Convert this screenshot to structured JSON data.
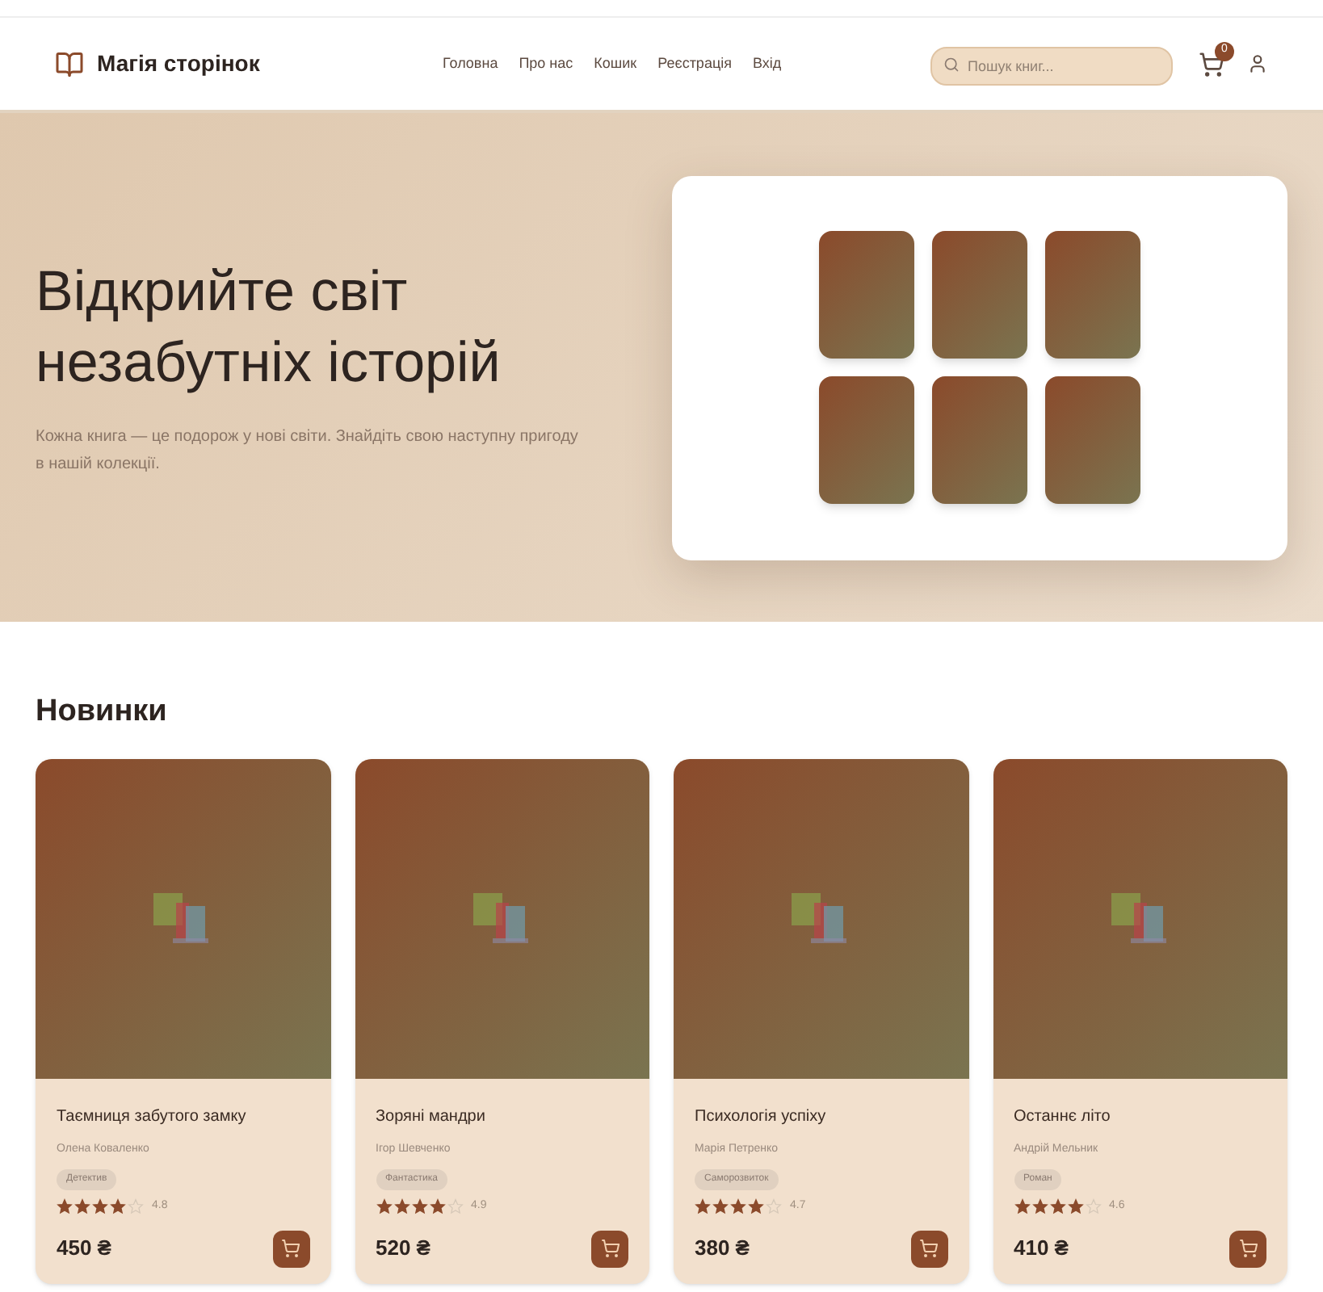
{
  "header": {
    "logo": "Магія сторінок",
    "nav": [
      {
        "label": "Головна"
      },
      {
        "label": "Про нас"
      },
      {
        "label": "Кошик"
      },
      {
        "label": "Реєстрація"
      },
      {
        "label": "Вхід"
      }
    ],
    "search": {
      "placeholder": "Пошук книг..."
    },
    "cart_count": "0"
  },
  "hero": {
    "title": "Відкрийте світ незабутніх історій",
    "subtitle": "Кожна книга — це подорож у нові світи. Знайдіть свою наступну пригоду в нашій колекції."
  },
  "section_title": "Новинки",
  "books": [
    {
      "title": "Таємниця забутого замку",
      "author": "Олена Коваленко",
      "genre": "Детектив",
      "stars": 4,
      "rating": "4.8",
      "price": "450 ₴"
    },
    {
      "title": "Зоряні мандри",
      "author": "Ігор Шевченко",
      "genre": "Фантастика",
      "stars": 4,
      "rating": "4.9",
      "price": "520 ₴"
    },
    {
      "title": "Психологія успіху",
      "author": "Марія Петренко",
      "genre": "Саморозвиток",
      "stars": 4,
      "rating": "4.7",
      "price": "380 ₴"
    },
    {
      "title": "Останнє літо",
      "author": "Андрій Мельник",
      "genre": "Роман",
      "stars": 4,
      "rating": "4.6",
      "price": "410 ₴"
    }
  ]
}
